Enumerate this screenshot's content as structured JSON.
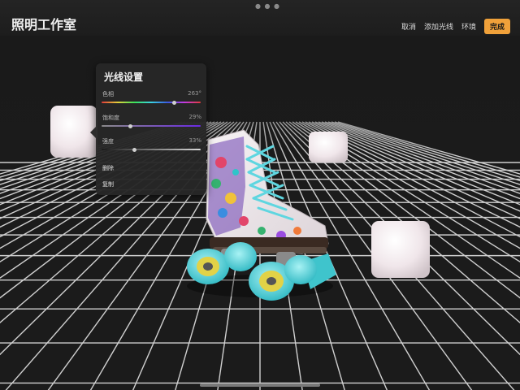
{
  "header": {
    "title": "照明工作室",
    "cancel_label": "取消",
    "add_light_label": "添加光线",
    "environment_label": "环境",
    "done_label": "完成",
    "accent_color": "#f0a13a"
  },
  "light_panel": {
    "title": "光线设置",
    "hue": {
      "label": "色相",
      "value": "263°",
      "level": 0.73
    },
    "saturation": {
      "label": "饱和度",
      "value": "29%",
      "level": 0.29
    },
    "intensity": {
      "label": "强度",
      "value": "33%",
      "level": 0.33
    },
    "delete_label": "删除",
    "duplicate_label": "复制"
  },
  "scene": {
    "object": "roller-skate",
    "lights": [
      "light-cube-left",
      "light-cube-center",
      "light-cube-right"
    ],
    "floor": "grid"
  }
}
